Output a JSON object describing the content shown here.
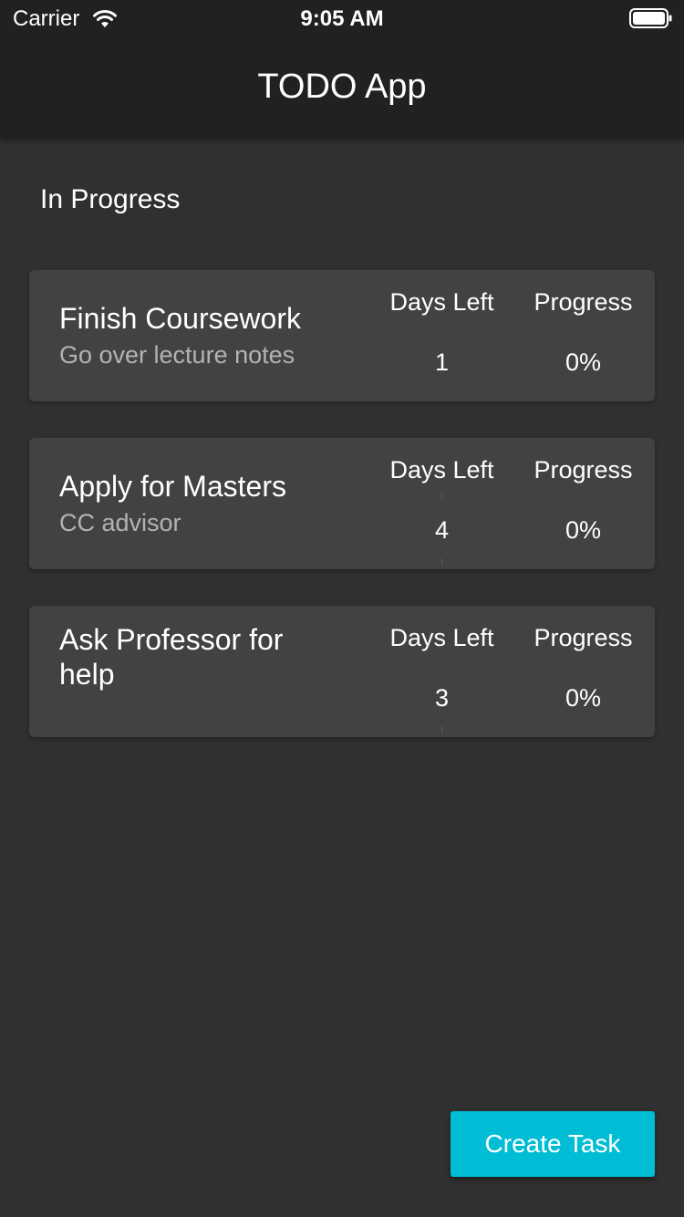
{
  "status_bar": {
    "carrier": "Carrier",
    "time": "9:05 AM",
    "wifi_icon": "wifi-icon",
    "battery_icon": "battery-icon"
  },
  "app_bar": {
    "title": "TODO App"
  },
  "section": {
    "title": "In Progress"
  },
  "tasks": [
    {
      "title": "Finish Coursework",
      "subtitle": "Go over lecture notes",
      "days_left_label": "Days Left",
      "days_left": "1",
      "progress_label": "Progress",
      "progress": "0%"
    },
    {
      "title": "Apply for Masters",
      "subtitle": "CC advisor",
      "days_left_label": "Days Left",
      "days_left": "4",
      "progress_label": "Progress",
      "progress": "0%"
    },
    {
      "title": "Ask Professor for help",
      "subtitle": "",
      "days_left_label": "Days Left",
      "days_left": "3",
      "progress_label": "Progress",
      "progress": "0%"
    }
  ],
  "actions": {
    "create_task_label": "Create Task"
  },
  "colors": {
    "background": "#303030",
    "app_bar": "#212121",
    "card": "#424242",
    "accent": "#00bcd4",
    "subtitle": "#b3b3b3"
  }
}
